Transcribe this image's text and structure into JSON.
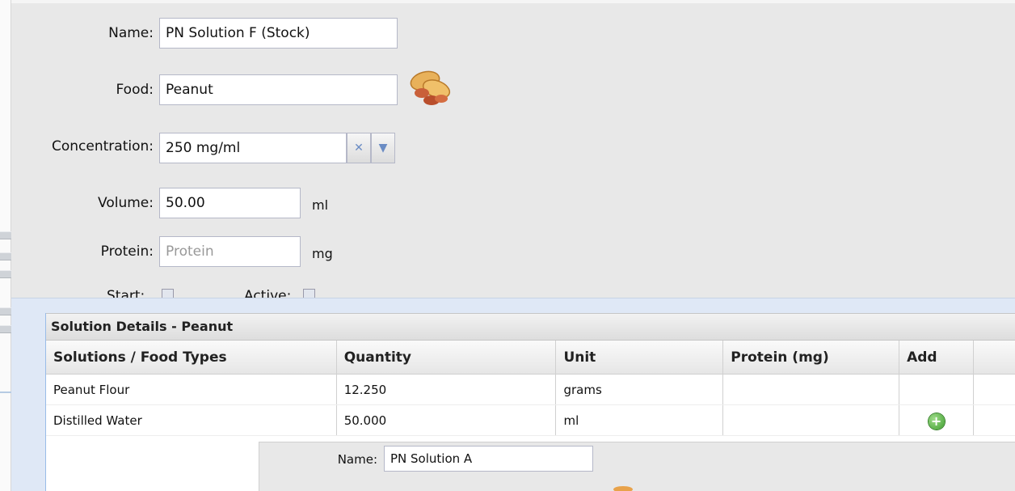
{
  "form": {
    "name_label": "Name:",
    "name_value": "PN Solution F (Stock)",
    "food_label": "Food:",
    "food_value": "Peanut",
    "concentration_label": "Concentration:",
    "concentration_value": "250 mg/ml",
    "volume_label": "Volume:",
    "volume_value": "50.00",
    "volume_unit": "ml",
    "protein_label": "Protein:",
    "protein_placeholder": "Protein",
    "protein_unit": "mg",
    "start_label": "Start:",
    "active_label": "Active:"
  },
  "grid": {
    "title": "Solution Details - Peanut",
    "columns": [
      "Solutions / Food Types",
      "Quantity",
      "Unit",
      "Protein (mg)",
      "Add"
    ],
    "rows": [
      {
        "type": "Peanut Flour",
        "quantity": "12.250",
        "unit": "grams",
        "protein": "",
        "add": false
      },
      {
        "type": "Distilled Water",
        "quantity": "50.000",
        "unit": "ml",
        "protein": "",
        "add": true
      }
    ]
  },
  "sub_form": {
    "name_label": "Name:",
    "name_value": "PN Solution A"
  },
  "icons": {
    "food": "peanut-icon",
    "clear": "clear-icon",
    "dropdown": "chevron-down-icon",
    "add": "add-icon"
  },
  "colors": {
    "form_bg": "#e8e8e8",
    "panel_bg": "#dfe8f6",
    "add_green": "#3e9e2e"
  }
}
